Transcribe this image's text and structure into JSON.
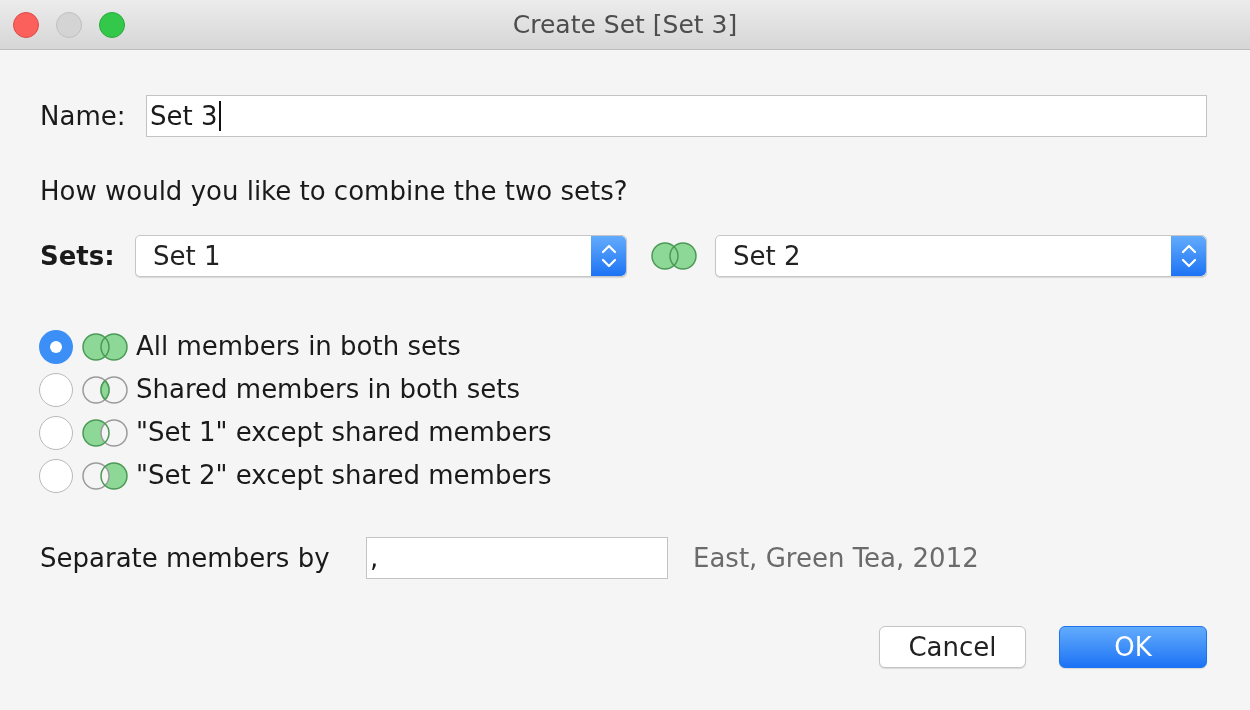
{
  "window": {
    "title": "Create Set [Set 3]",
    "controls": [
      {
        "kind": "close",
        "disabled": false
      },
      {
        "kind": "minimize",
        "disabled": true
      },
      {
        "kind": "zoom",
        "disabled": false
      }
    ]
  },
  "name_field": {
    "label": "Name:",
    "value": "Set 3",
    "focused": true
  },
  "question": "How would you like to combine the two sets?",
  "sets": {
    "label": "Sets:",
    "left": {
      "value": "Set 1"
    },
    "right": {
      "value": "Set 2"
    }
  },
  "options": [
    {
      "kind": "all",
      "label": "All members in both sets",
      "selected": true
    },
    {
      "kind": "shared",
      "label": "Shared members in both sets",
      "selected": false
    },
    {
      "kind": "left",
      "label": "\"Set 1\" except shared members",
      "selected": false
    },
    {
      "kind": "right",
      "label": "\"Set 2\" except shared members",
      "selected": false
    }
  ],
  "separator": {
    "label": "Separate members by",
    "value": ",",
    "example": "East, Green Tea, 2012"
  },
  "buttons": [
    {
      "kind": "secondary",
      "label": "Cancel"
    },
    {
      "kind": "primary",
      "label": "OK"
    }
  ]
}
